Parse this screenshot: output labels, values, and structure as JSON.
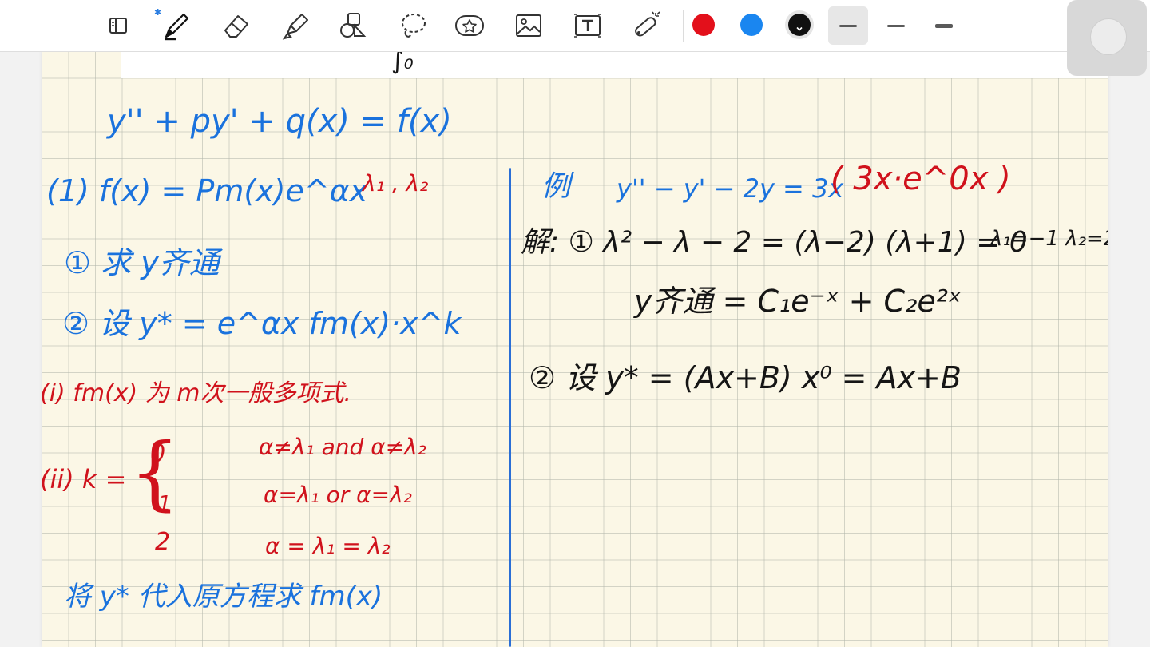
{
  "toolbar": {
    "tools": [
      {
        "name": "pages-tool",
        "icon": "pages-icon"
      },
      {
        "name": "pen-tool",
        "icon": "pen-icon"
      },
      {
        "name": "eraser-tool",
        "icon": "eraser-icon"
      },
      {
        "name": "highlighter-tool",
        "icon": "highlighter-icon"
      },
      {
        "name": "shapes-tool",
        "icon": "shapes-icon"
      },
      {
        "name": "lasso-tool",
        "icon": "lasso-icon"
      },
      {
        "name": "sticker-tool",
        "icon": "sticker-icon"
      },
      {
        "name": "image-tool",
        "icon": "image-icon"
      },
      {
        "name": "text-tool",
        "icon": "text-icon"
      },
      {
        "name": "laser-pointer-tool",
        "icon": "laser-pointer-icon"
      }
    ],
    "bluetooth_icon": "bluetooth-icon",
    "colors": {
      "red": "#e3101b",
      "blue": "#1a86f0",
      "black": "#111111"
    },
    "selected_color": "black",
    "stroke_widths": [
      "thin",
      "medium",
      "thick"
    ],
    "selected_stroke": "thin"
  },
  "note": {
    "prev_tail": "∫₀",
    "eq_main": "y'' + py' + q(x) = f(x)",
    "case1_head": "(1)  f(x) = Pm(x)e^αx",
    "case1_roots": "λ₁ , λ₂",
    "step1": "①  求 y齐通",
    "step2": "②  设 y* = e^αx fm(x)·x^k",
    "note_i": "(i) fm(x) 为 m次一般多项式.",
    "note_ii": "(ii)  k =",
    "k_values": [
      "0",
      "1",
      "2"
    ],
    "k_conditions": [
      "α≠λ₁ and α≠λ₂",
      "α=λ₁ or  α=λ₂",
      "α = λ₁ = λ₂"
    ],
    "bottom": "将 y* 代入原方程求 fm(x)",
    "example_label": "例",
    "example_eq": "y'' − y' − 2y = 3x",
    "example_note": "( 3x·e^0x )",
    "sol_step1": "解: ①  λ² − λ − 2 = (λ−2)  (λ+1) = 0",
    "sol_roots": "λ₁=−1  λ₂=2",
    "sol_general": "y齐通 = C₁e⁻ˣ + C₂e²ˣ",
    "sol_step2": "② 设 y* = (Ax+B) x⁰ = Ax+B"
  }
}
